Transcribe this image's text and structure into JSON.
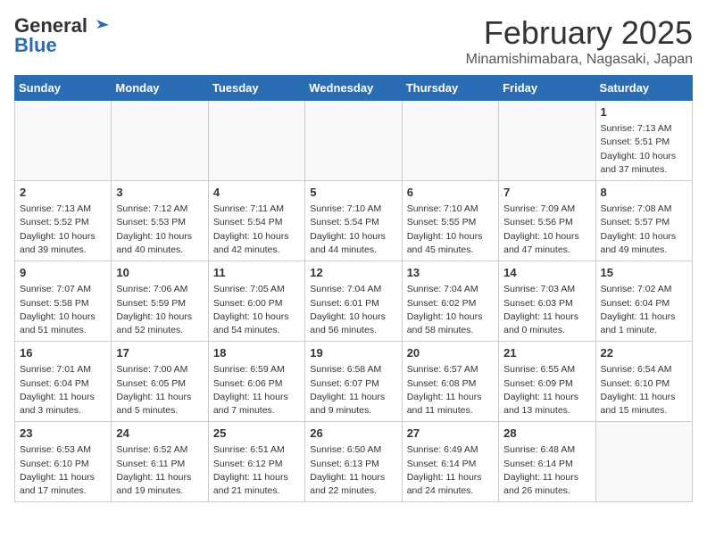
{
  "header": {
    "logo_general": "General",
    "logo_blue": "Blue",
    "month_title": "February 2025",
    "location": "Minamishimabara, Nagasaki, Japan"
  },
  "weekdays": [
    "Sunday",
    "Monday",
    "Tuesday",
    "Wednesday",
    "Thursday",
    "Friday",
    "Saturday"
  ],
  "weeks": [
    [
      {
        "day": "",
        "info": ""
      },
      {
        "day": "",
        "info": ""
      },
      {
        "day": "",
        "info": ""
      },
      {
        "day": "",
        "info": ""
      },
      {
        "day": "",
        "info": ""
      },
      {
        "day": "",
        "info": ""
      },
      {
        "day": "1",
        "info": "Sunrise: 7:13 AM\nSunset: 5:51 PM\nDaylight: 10 hours and 37 minutes."
      }
    ],
    [
      {
        "day": "2",
        "info": "Sunrise: 7:13 AM\nSunset: 5:52 PM\nDaylight: 10 hours and 39 minutes."
      },
      {
        "day": "3",
        "info": "Sunrise: 7:12 AM\nSunset: 5:53 PM\nDaylight: 10 hours and 40 minutes."
      },
      {
        "day": "4",
        "info": "Sunrise: 7:11 AM\nSunset: 5:54 PM\nDaylight: 10 hours and 42 minutes."
      },
      {
        "day": "5",
        "info": "Sunrise: 7:10 AM\nSunset: 5:54 PM\nDaylight: 10 hours and 44 minutes."
      },
      {
        "day": "6",
        "info": "Sunrise: 7:10 AM\nSunset: 5:55 PM\nDaylight: 10 hours and 45 minutes."
      },
      {
        "day": "7",
        "info": "Sunrise: 7:09 AM\nSunset: 5:56 PM\nDaylight: 10 hours and 47 minutes."
      },
      {
        "day": "8",
        "info": "Sunrise: 7:08 AM\nSunset: 5:57 PM\nDaylight: 10 hours and 49 minutes."
      }
    ],
    [
      {
        "day": "9",
        "info": "Sunrise: 7:07 AM\nSunset: 5:58 PM\nDaylight: 10 hours and 51 minutes."
      },
      {
        "day": "10",
        "info": "Sunrise: 7:06 AM\nSunset: 5:59 PM\nDaylight: 10 hours and 52 minutes."
      },
      {
        "day": "11",
        "info": "Sunrise: 7:05 AM\nSunset: 6:00 PM\nDaylight: 10 hours and 54 minutes."
      },
      {
        "day": "12",
        "info": "Sunrise: 7:04 AM\nSunset: 6:01 PM\nDaylight: 10 hours and 56 minutes."
      },
      {
        "day": "13",
        "info": "Sunrise: 7:04 AM\nSunset: 6:02 PM\nDaylight: 10 hours and 58 minutes."
      },
      {
        "day": "14",
        "info": "Sunrise: 7:03 AM\nSunset: 6:03 PM\nDaylight: 11 hours and 0 minutes."
      },
      {
        "day": "15",
        "info": "Sunrise: 7:02 AM\nSunset: 6:04 PM\nDaylight: 11 hours and 1 minute."
      }
    ],
    [
      {
        "day": "16",
        "info": "Sunrise: 7:01 AM\nSunset: 6:04 PM\nDaylight: 11 hours and 3 minutes."
      },
      {
        "day": "17",
        "info": "Sunrise: 7:00 AM\nSunset: 6:05 PM\nDaylight: 11 hours and 5 minutes."
      },
      {
        "day": "18",
        "info": "Sunrise: 6:59 AM\nSunset: 6:06 PM\nDaylight: 11 hours and 7 minutes."
      },
      {
        "day": "19",
        "info": "Sunrise: 6:58 AM\nSunset: 6:07 PM\nDaylight: 11 hours and 9 minutes."
      },
      {
        "day": "20",
        "info": "Sunrise: 6:57 AM\nSunset: 6:08 PM\nDaylight: 11 hours and 11 minutes."
      },
      {
        "day": "21",
        "info": "Sunrise: 6:55 AM\nSunset: 6:09 PM\nDaylight: 11 hours and 13 minutes."
      },
      {
        "day": "22",
        "info": "Sunrise: 6:54 AM\nSunset: 6:10 PM\nDaylight: 11 hours and 15 minutes."
      }
    ],
    [
      {
        "day": "23",
        "info": "Sunrise: 6:53 AM\nSunset: 6:10 PM\nDaylight: 11 hours and 17 minutes."
      },
      {
        "day": "24",
        "info": "Sunrise: 6:52 AM\nSunset: 6:11 PM\nDaylight: 11 hours and 19 minutes."
      },
      {
        "day": "25",
        "info": "Sunrise: 6:51 AM\nSunset: 6:12 PM\nDaylight: 11 hours and 21 minutes."
      },
      {
        "day": "26",
        "info": "Sunrise: 6:50 AM\nSunset: 6:13 PM\nDaylight: 11 hours and 22 minutes."
      },
      {
        "day": "27",
        "info": "Sunrise: 6:49 AM\nSunset: 6:14 PM\nDaylight: 11 hours and 24 minutes."
      },
      {
        "day": "28",
        "info": "Sunrise: 6:48 AM\nSunset: 6:14 PM\nDaylight: 11 hours and 26 minutes."
      },
      {
        "day": "",
        "info": ""
      }
    ]
  ]
}
